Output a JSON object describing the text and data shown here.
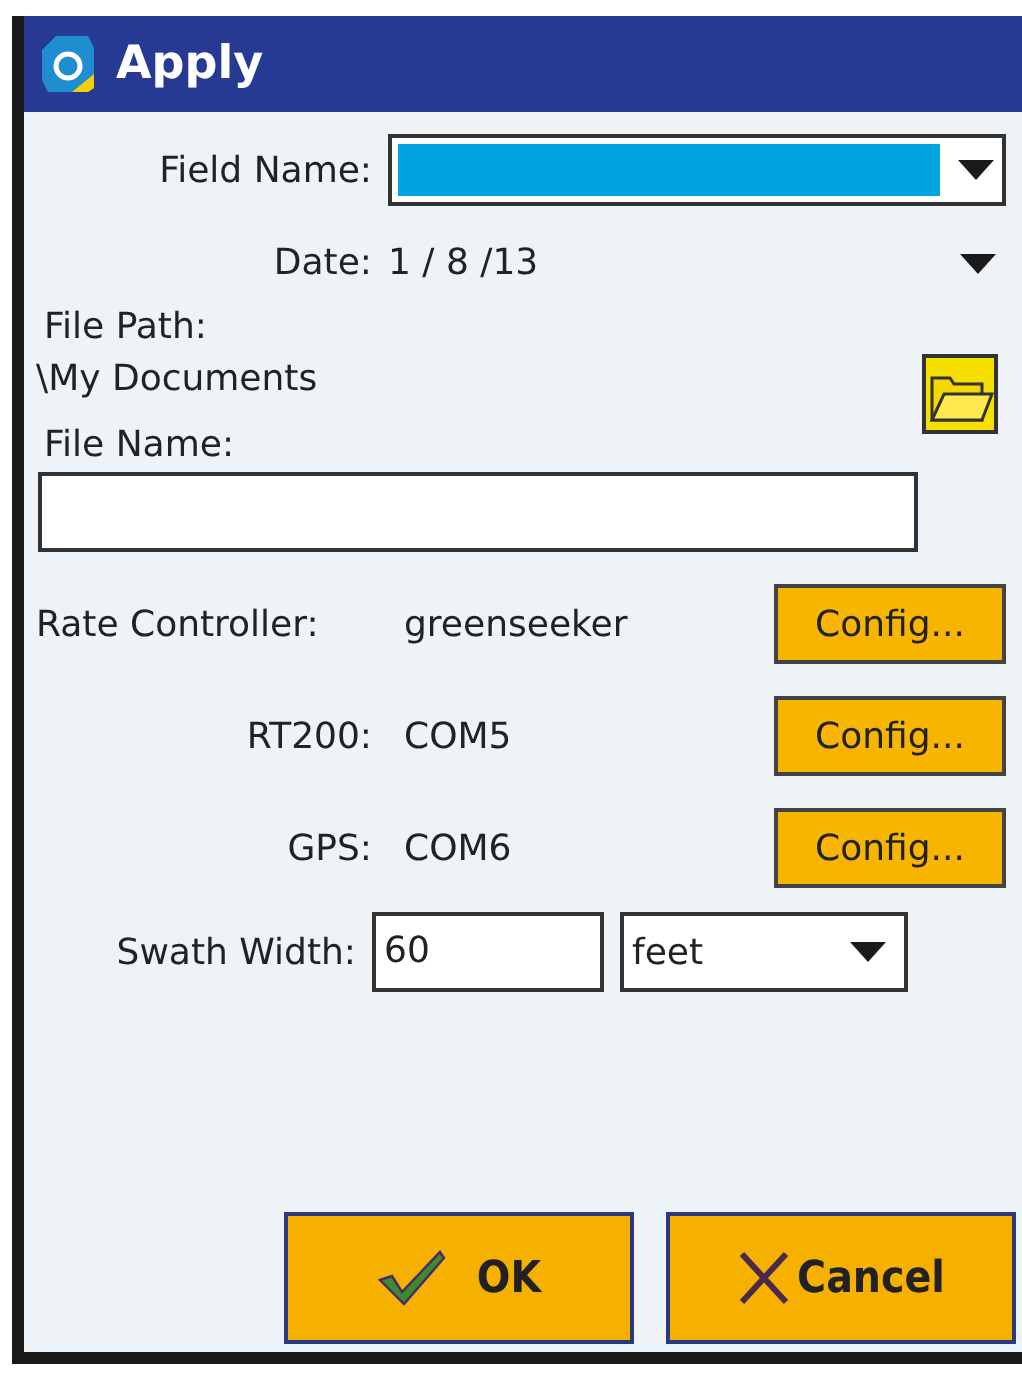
{
  "window": {
    "title": "Apply"
  },
  "field_name": {
    "label": "Field Name:",
    "selected": true
  },
  "date": {
    "label": "Date:",
    "value": "1 / 8 /13"
  },
  "file_path": {
    "label": "File Path:",
    "value": "\\My Documents"
  },
  "file_name": {
    "label": "File Name:"
  },
  "devices": [
    {
      "label": "Rate Controller:",
      "value": "greenseeker",
      "button": "Config..."
    },
    {
      "label": "RT200:",
      "value": "COM5",
      "button": "Config..."
    },
    {
      "label": "GPS:",
      "value": "COM6",
      "button": "Config..."
    }
  ],
  "swath_width": {
    "label": "Swath Width:",
    "value": "60",
    "unit": "feet"
  },
  "buttons": [
    {
      "kind": "ok",
      "label": "OK"
    },
    {
      "kind": "cancel",
      "label": "Cancel"
    }
  ]
}
